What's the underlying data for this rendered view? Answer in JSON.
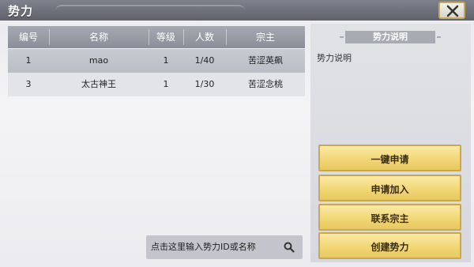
{
  "window": {
    "title": "势力",
    "close_icon": "close-icon"
  },
  "table": {
    "headers": [
      "编号",
      "名称",
      "等级",
      "人数",
      "宗主"
    ],
    "rows": [
      {
        "id": "1",
        "name": "mao",
        "level": "1",
        "members": "1/40",
        "leader": "苦涩英飙",
        "selected": true
      },
      {
        "id": "3",
        "name": "太古神王",
        "level": "1",
        "members": "1/30",
        "leader": "苦涩念桃",
        "selected": false
      }
    ]
  },
  "search": {
    "placeholder": "点击这里输入势力ID或名称",
    "icon": "search-icon"
  },
  "info": {
    "title": "势力说明",
    "text": "势力说明"
  },
  "buttons": {
    "quick_apply": "一键申请",
    "apply_join": "申请加入",
    "contact_leader": "联系宗主",
    "create_faction": "创建势力"
  },
  "colors": {
    "button_gold": "#f1d776",
    "header_gray": "#a6a9b2",
    "selected_row": "#c9cbd2"
  }
}
